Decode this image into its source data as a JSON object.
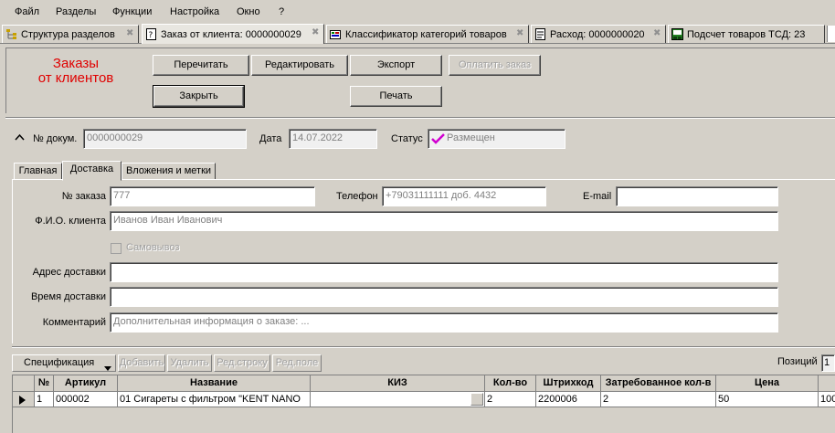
{
  "menu": [
    "Файл",
    "Разделы",
    "Функции",
    "Настройка",
    "Окно",
    "?"
  ],
  "tabs": [
    {
      "label": "Структура разделов",
      "icon": "tree-icon"
    },
    {
      "label": "Заказ от клиента: 0000000029",
      "icon": "document-question-icon"
    },
    {
      "label": "Классификатор категорий товаров",
      "icon": "classifier-icon"
    },
    {
      "label": "Расход: 0000000020",
      "icon": "document-icon"
    },
    {
      "label": "Подсчет товаров ТСД: 23",
      "icon": "barcode-terminal-icon"
    }
  ],
  "header": {
    "title_line1": "Заказы",
    "title_line2": "от клиентов",
    "buttons": {
      "reread": "Перечитать",
      "edit": "Редактировать",
      "export": "Экспорт",
      "pay": "Оплатить заказ",
      "close": "Закрыть",
      "print": "Печать"
    }
  },
  "doc": {
    "num_label": "№ докум.",
    "num_value": "0000000029",
    "date_label": "Дата",
    "date_value": "14.07.2022",
    "status_label": "Статус",
    "status_value": "Размещен",
    "collapse_glyph": "^"
  },
  "page_tabs": [
    "Главная",
    "Доставка",
    "Вложения и метки"
  ],
  "delivery": {
    "order_no_label": "№ заказа",
    "order_no_value": "777",
    "phone_label": "Телефон",
    "phone_value": "+79031111111 доб. 4432",
    "email_label": "E-mail",
    "email_value": "",
    "client_label": "Ф.И.О. клиента",
    "client_value": "Иванов Иван Иванович",
    "pickup_label": "Самовывоз",
    "address_label": "Адрес доставки",
    "address_value": "",
    "time_label": "Время доставки",
    "time_value": "",
    "comment_label": "Комментарий",
    "comment_placeholder": "Дополнительная информация о заказе: ..."
  },
  "spec": {
    "menu_label": "Спецификация",
    "add": "Добавить",
    "delete": "Удалить",
    "edit_row": "Ред.строку",
    "edit_field": "Ред.поле",
    "positions_label": "Позиций",
    "positions_value": "1"
  },
  "grid": {
    "columns": [
      "№",
      "Артикул",
      "Название",
      "КИЗ",
      "Кол-во",
      "Штрихкод",
      "Затребованное кол-в",
      "Цена",
      ""
    ],
    "rows": [
      [
        "1",
        "000002",
        "01 Сигареты с фильтром  \"KENT NANO",
        "",
        "2",
        "2200006",
        "2",
        "50",
        "100"
      ]
    ]
  },
  "colors": {
    "title": "#e00000",
    "window_bg": "#d4d0c8",
    "status_check": "#d000d0"
  }
}
